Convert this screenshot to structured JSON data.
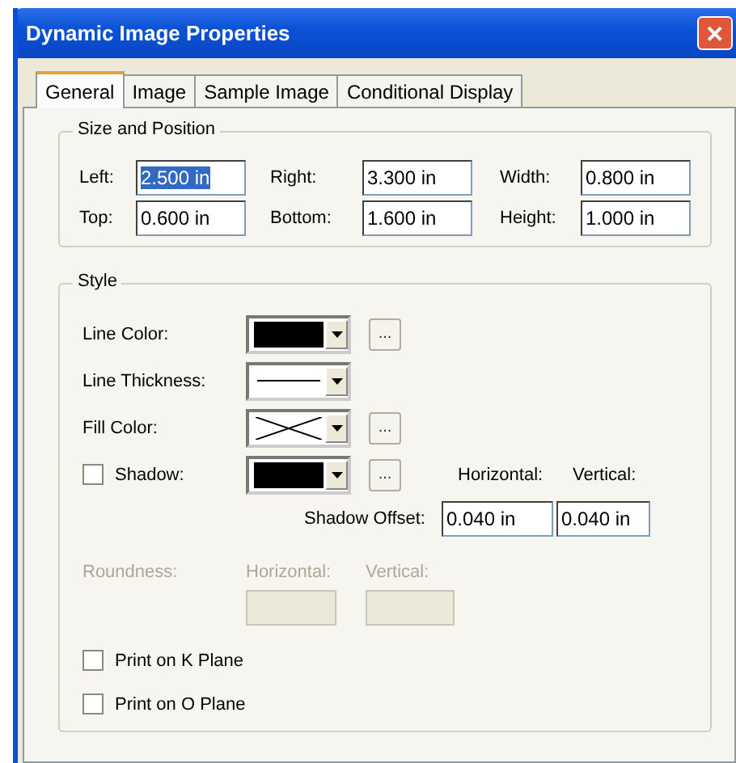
{
  "window": {
    "title": "Dynamic Image Properties",
    "close": "✕"
  },
  "tabs": [
    {
      "label": "General",
      "selected": true
    },
    {
      "label": "Image",
      "selected": false
    },
    {
      "label": "Sample Image",
      "selected": false
    },
    {
      "label": "Conditional Display",
      "selected": false
    }
  ],
  "size_and_position": {
    "title": "Size and Position",
    "fields": [
      {
        "label": "Left:",
        "value": "2.500 in",
        "selected": true
      },
      {
        "label": "Right:",
        "value": "3.300 in",
        "selected": false
      },
      {
        "label": "Width:",
        "value": "0.800 in",
        "selected": false
      },
      {
        "label": "Top:",
        "value": "0.600 in",
        "selected": false
      },
      {
        "label": "Bottom:",
        "value": "1.600 in",
        "selected": false
      },
      {
        "label": "Height:",
        "value": "1.000 in",
        "selected": false
      }
    ]
  },
  "style": {
    "title": "Style",
    "rows": [
      {
        "kind": "color",
        "label": "Line Color:",
        "color": "#000000",
        "button": "..."
      },
      {
        "kind": "thickness",
        "label": "Line Thickness:"
      },
      {
        "kind": "color",
        "label": "Fill Color:",
        "button": "..."
      },
      {
        "kind": "check_color",
        "label": "Shadow:",
        "checked": false,
        "color": "#000000",
        "button": "..."
      }
    ],
    "shadow_offset": {
      "label": "Shadow Offset:",
      "columns": [
        "Horizontal:",
        "Vertical:"
      ],
      "values": [
        "0.040 in",
        "0.040 in"
      ]
    },
    "roundness": {
      "label": "Roundness:",
      "disabled": true,
      "columns": [
        "Horizontal:",
        "Vertical:"
      ]
    },
    "checks": [
      {
        "label": "Print on K Plane",
        "checked": false
      },
      {
        "label": "Print on O Plane",
        "checked": false
      }
    ]
  }
}
